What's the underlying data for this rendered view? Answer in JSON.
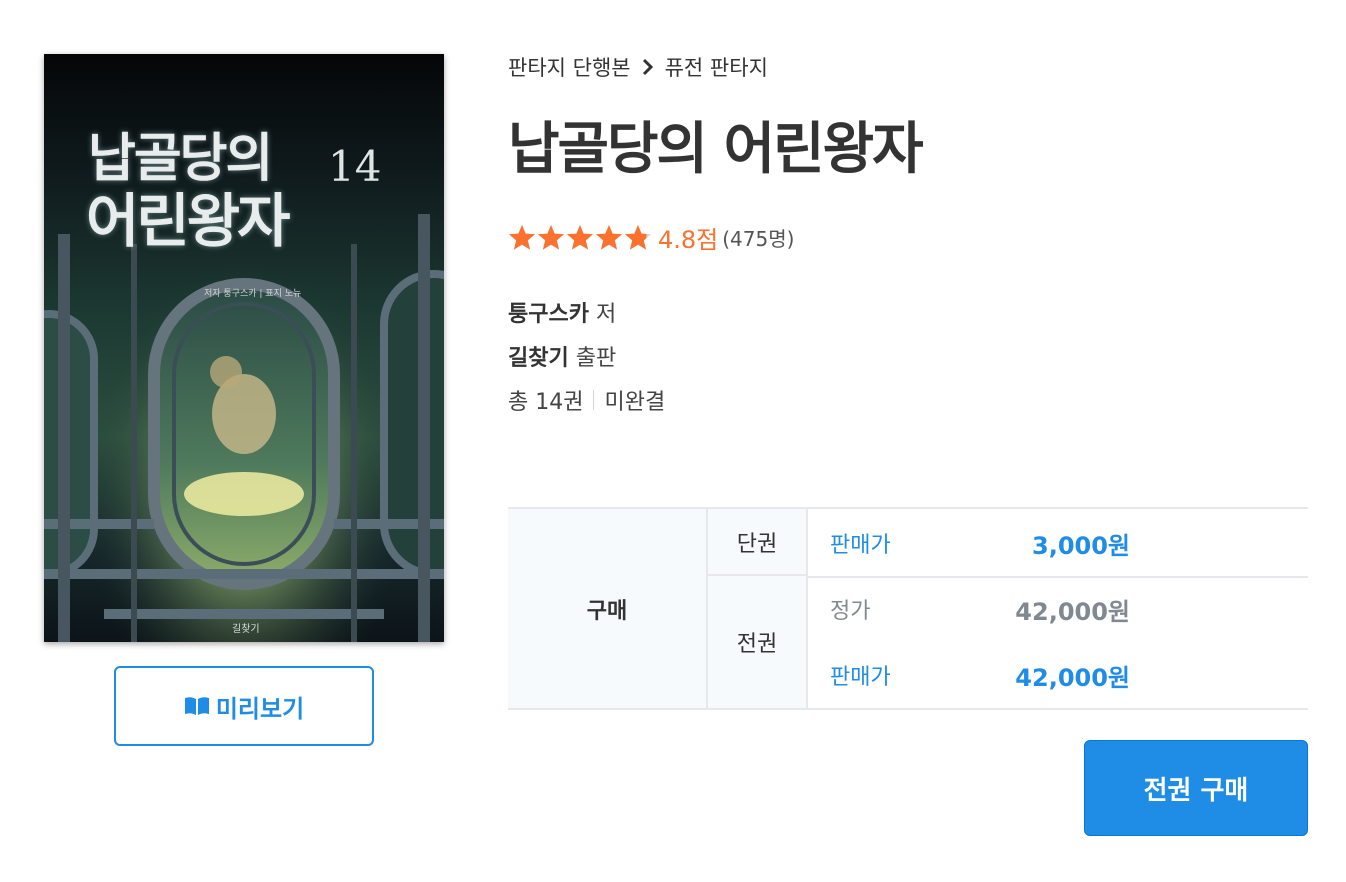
{
  "cover": {
    "title_line1": "납골당의",
    "title_line2": "어린왕자",
    "volume": "14",
    "credit": "저자 퉁구스카 | 표지 노뉴",
    "publisher_mark": "길찾기"
  },
  "preview": {
    "label": "미리보기",
    "icon": "open-book-icon"
  },
  "breadcrumb": {
    "category": "판타지 단행본",
    "subcategory": "퓨전 판타지"
  },
  "book": {
    "title": "납골당의 어린왕자",
    "rating": {
      "stars": 4.8,
      "max_stars": 5,
      "score_label": "4.8점",
      "count_label": "(475명)"
    },
    "author": "퉁구스카",
    "author_suffix": "저",
    "publisher": "길찾기",
    "publisher_suffix": "출판",
    "total": "총 14권",
    "status": "미완결"
  },
  "price_table": {
    "buy_label": "구매",
    "single": {
      "type": "단권",
      "sale_label": "판매가",
      "sale_price": "3,000원"
    },
    "all": {
      "type": "전권",
      "list_label": "정가",
      "list_price": "42,000원",
      "sale_label": "판매가",
      "sale_price": "42,000원"
    }
  },
  "buy_all_button": {
    "label": "전권 구매"
  },
  "colors": {
    "accent": "#1f8ce6",
    "star": "#fa722e",
    "border": "#e6e8eb",
    "muted": "#808991"
  }
}
